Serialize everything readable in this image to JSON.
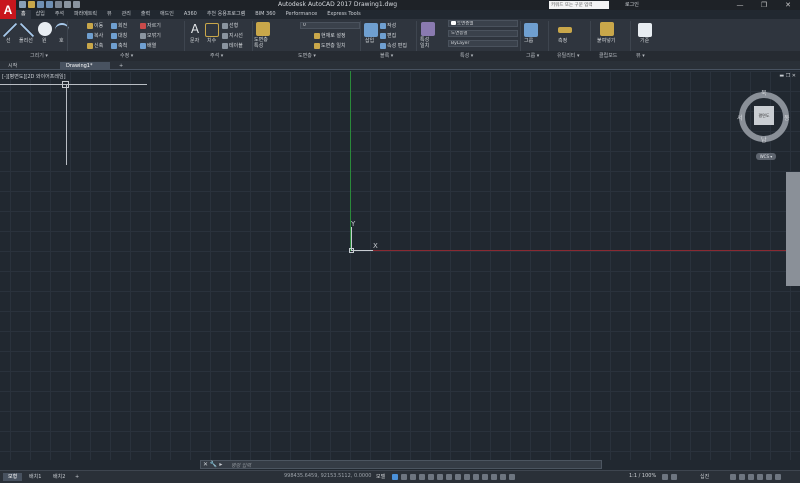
{
  "app": {
    "logo_letter": "A",
    "title": "Autodesk AutoCAD 2017    Drawing1.dwg",
    "search_placeholder": "키워드 또는 구문 입력",
    "signin": "로그인",
    "window_buttons": [
      "—",
      "❐",
      "✕"
    ]
  },
  "ribbon_tabs": [
    "홈",
    "삽입",
    "주석",
    "파라메트릭",
    "뷰",
    "관리",
    "출력",
    "애드인",
    "A360",
    "추천 응용프로그램",
    "BIM 360",
    "Performance",
    "Express Tools"
  ],
  "active_tab": "홈",
  "ribbon": {
    "draw": {
      "line": "선",
      "polyline": "폴리선",
      "circle": "원",
      "arc": "호"
    },
    "modify": {
      "move": "이동",
      "rotate": "회전",
      "trim": "자르기",
      "copy": "복사",
      "mirror": "대칭",
      "fillet": "모깎기",
      "stretch": "신축",
      "scale": "축척",
      "array": "배열"
    },
    "annotation": {
      "text": "문자",
      "dimension": "치수",
      "leader": "지시선",
      "table": "테이블",
      "linear": "선형"
    },
    "layers": {
      "layer_properties": "도면층 특성",
      "layer_current": "0",
      "make_current": "현재로 설정",
      "match_layer": "도면층 일치"
    },
    "block": {
      "insert": "삽입",
      "create": "작성",
      "edit": "편집",
      "edit_attributes": "속성 편집"
    },
    "properties": {
      "match": "특성 일치",
      "color": "도면층별",
      "linetype": "도면층별",
      "lineweight": "ByLayer"
    },
    "groups": {
      "group": "그룹"
    },
    "utilities": {
      "measure": "측정"
    },
    "clipboard": {
      "paste": "붙여넣기"
    },
    "view_base": {
      "base": "기준"
    }
  },
  "panel_labels": [
    "그리기 ▾",
    "수정 ▾",
    "주석 ▾",
    "도면층 ▾",
    "블록 ▾",
    "특성 ▾",
    "그룹 ▾",
    "유틸리티 ▾",
    "클립보드",
    "뷰 ▾"
  ],
  "doc_tabs": [
    "시작",
    "Drawing1*",
    "+"
  ],
  "active_doc_tab": "Drawing1*",
  "viewport": {
    "label": "[-][평면도][2D 와이어프레임]",
    "ucs_x": "X",
    "ucs_y": "Y",
    "window_controls": "▬ ❐ ✕"
  },
  "viewcube": {
    "face": "평면도",
    "north": "북",
    "south": "남",
    "east": "동",
    "west": "서",
    "wcs": "WCS ▾"
  },
  "command_line": {
    "icons": "✕ 🔧 ▸",
    "prompt": "명령 입력"
  },
  "layout_tabs": [
    "모형",
    "배치1",
    "배치2",
    "+"
  ],
  "active_layout_tab": "모형",
  "status": {
    "coordinates": "998435.6459, 92153.5112, 0.0000",
    "model": "모델",
    "scale": "1:1 / 100%",
    "decimal": "십진"
  },
  "colors": {
    "background": "#212830",
    "ribbon": "#2f353e",
    "accent_red": "#c8161d",
    "y_axis": "#2a8a3a",
    "x_axis": "#8a2a32"
  }
}
